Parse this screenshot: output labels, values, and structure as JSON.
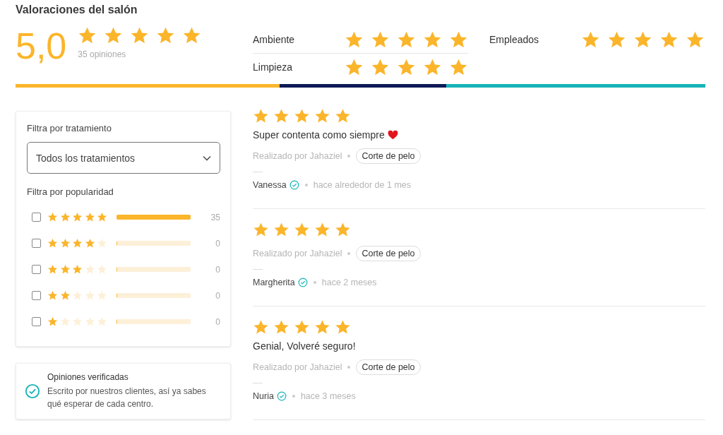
{
  "title": "Valoraciones del salón",
  "summary": {
    "score": "5,0",
    "stars": 5,
    "count": "35 opiniones"
  },
  "categories": [
    {
      "label": "Ambiente",
      "stars": 5
    },
    {
      "label": "Empleados",
      "stars": 5
    },
    {
      "label": "Limpieza",
      "stars": 5
    }
  ],
  "filters": {
    "treatment_label": "Filtra por tratamiento",
    "treatment_select": "Todos los tratamientos",
    "popularity_label": "Filtra por popularidad",
    "rows": [
      {
        "stars": 5,
        "checked": false,
        "level": 1,
        "count": "35"
      },
      {
        "stars": 4,
        "checked": false,
        "level": 0,
        "count": "0"
      },
      {
        "stars": 3,
        "checked": false,
        "level": 0,
        "count": "0"
      },
      {
        "stars": 2,
        "checked": false,
        "level": 0,
        "count": "0"
      },
      {
        "stars": 1,
        "checked": false,
        "level": 0,
        "count": "0"
      }
    ]
  },
  "verified": {
    "title": "Opiniones verificadas",
    "text": "Escrito por nuestros clientes, así ya sabes qué esperar de cada centro."
  },
  "reviews": [
    {
      "stars": 5,
      "title": "Super contenta como siempre",
      "heart": true,
      "done_by": "Realizado por Jahaziel",
      "service": "Corte de pelo",
      "author": "Vanessa",
      "verified": true,
      "time": "hace alrededor de 1 mes"
    },
    {
      "stars": 5,
      "done_by": "Realizado por Jahaziel",
      "service": "Corte de pelo",
      "author": "Margherita",
      "verified": true,
      "time": "hace 2 meses"
    },
    {
      "stars": 5,
      "title": "Genial, Volveré seguro!",
      "heart": false,
      "done_by": "Realizado por Jahaziel",
      "service": "Corte de pelo",
      "author": "Nuria",
      "verified": true,
      "time": "hace 3 meses"
    }
  ]
}
